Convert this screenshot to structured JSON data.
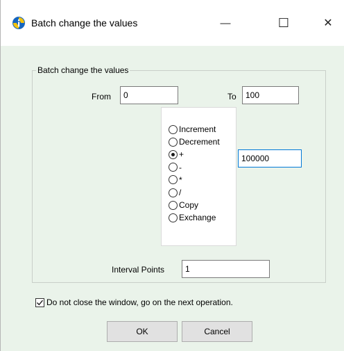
{
  "window": {
    "title": "Batch change the values",
    "app_icon": "info-icon",
    "controls": {
      "minimize": "—",
      "maximize": "☐",
      "close": "✕"
    }
  },
  "group": {
    "legend": "Batch change the values",
    "from_label": "From",
    "from_value": "0",
    "to_label": "To",
    "to_value": "100",
    "operand_value": "100000",
    "interval_label": "Interval Points",
    "interval_value": "1"
  },
  "operations": [
    {
      "label": "Increment",
      "checked": false
    },
    {
      "label": "Decrement",
      "checked": false
    },
    {
      "label": "+",
      "checked": true
    },
    {
      "label": "-",
      "checked": false
    },
    {
      "label": "*",
      "checked": false
    },
    {
      "label": "/",
      "checked": false
    },
    {
      "label": "Copy",
      "checked": false
    },
    {
      "label": "Exchange",
      "checked": false
    }
  ],
  "checkbox": {
    "label": "Do not close the window, go on the next operation.",
    "checked": true
  },
  "buttons": {
    "ok": "OK",
    "cancel": "Cancel"
  },
  "colors": {
    "dialog_bg": "#eaf3ea",
    "focus_border": "#0078d7",
    "icon_blue": "#1565c0",
    "icon_yellow": "#f4c20d"
  }
}
